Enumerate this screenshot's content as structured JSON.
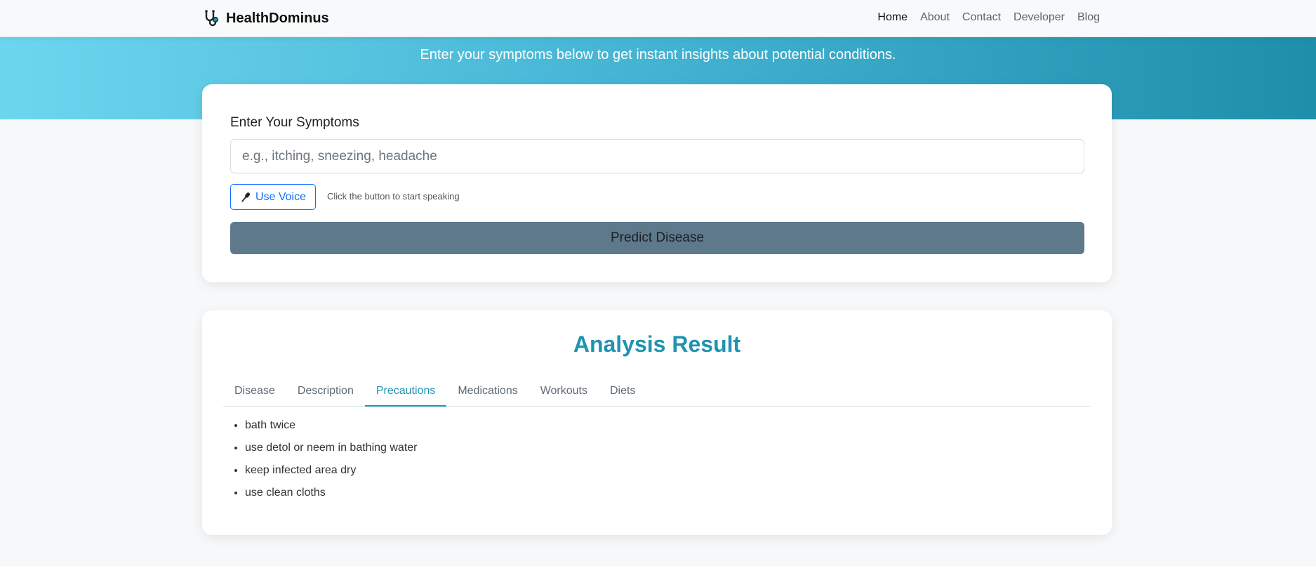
{
  "navbar": {
    "brand": "HealthDominus",
    "links": [
      {
        "label": "Home",
        "active": true
      },
      {
        "label": "About",
        "active": false
      },
      {
        "label": "Contact",
        "active": false
      },
      {
        "label": "Developer",
        "active": false
      },
      {
        "label": "Blog",
        "active": false
      }
    ]
  },
  "hero": {
    "subtitle": "Enter your symptoms below to get instant insights about potential conditions."
  },
  "form": {
    "label": "Enter Your Symptoms",
    "placeholder": "e.g., itching, sneezing, headache",
    "value": "",
    "voice_button": "Use Voice",
    "voice_hint": "Click the button to start speaking",
    "submit_button": "Predict Disease"
  },
  "result": {
    "title": "Analysis Result",
    "tabs": [
      {
        "label": "Disease",
        "active": false
      },
      {
        "label": "Description",
        "active": false
      },
      {
        "label": "Precautions",
        "active": true
      },
      {
        "label": "Medications",
        "active": false
      },
      {
        "label": "Workouts",
        "active": false
      },
      {
        "label": "Diets",
        "active": false
      }
    ],
    "precautions": [
      "bath twice",
      "use detol or neem in bathing water",
      "keep infected area dry",
      "use clean cloths"
    ]
  },
  "colors": {
    "accent": "#1f93b0",
    "primary": "#0d6efd",
    "predict_button": "#5e788c",
    "hero_start": "#6dd6ef",
    "hero_end": "#1e8eab"
  },
  "icons": {
    "brand": "stethoscope-icon",
    "voice": "microphone-icon"
  }
}
